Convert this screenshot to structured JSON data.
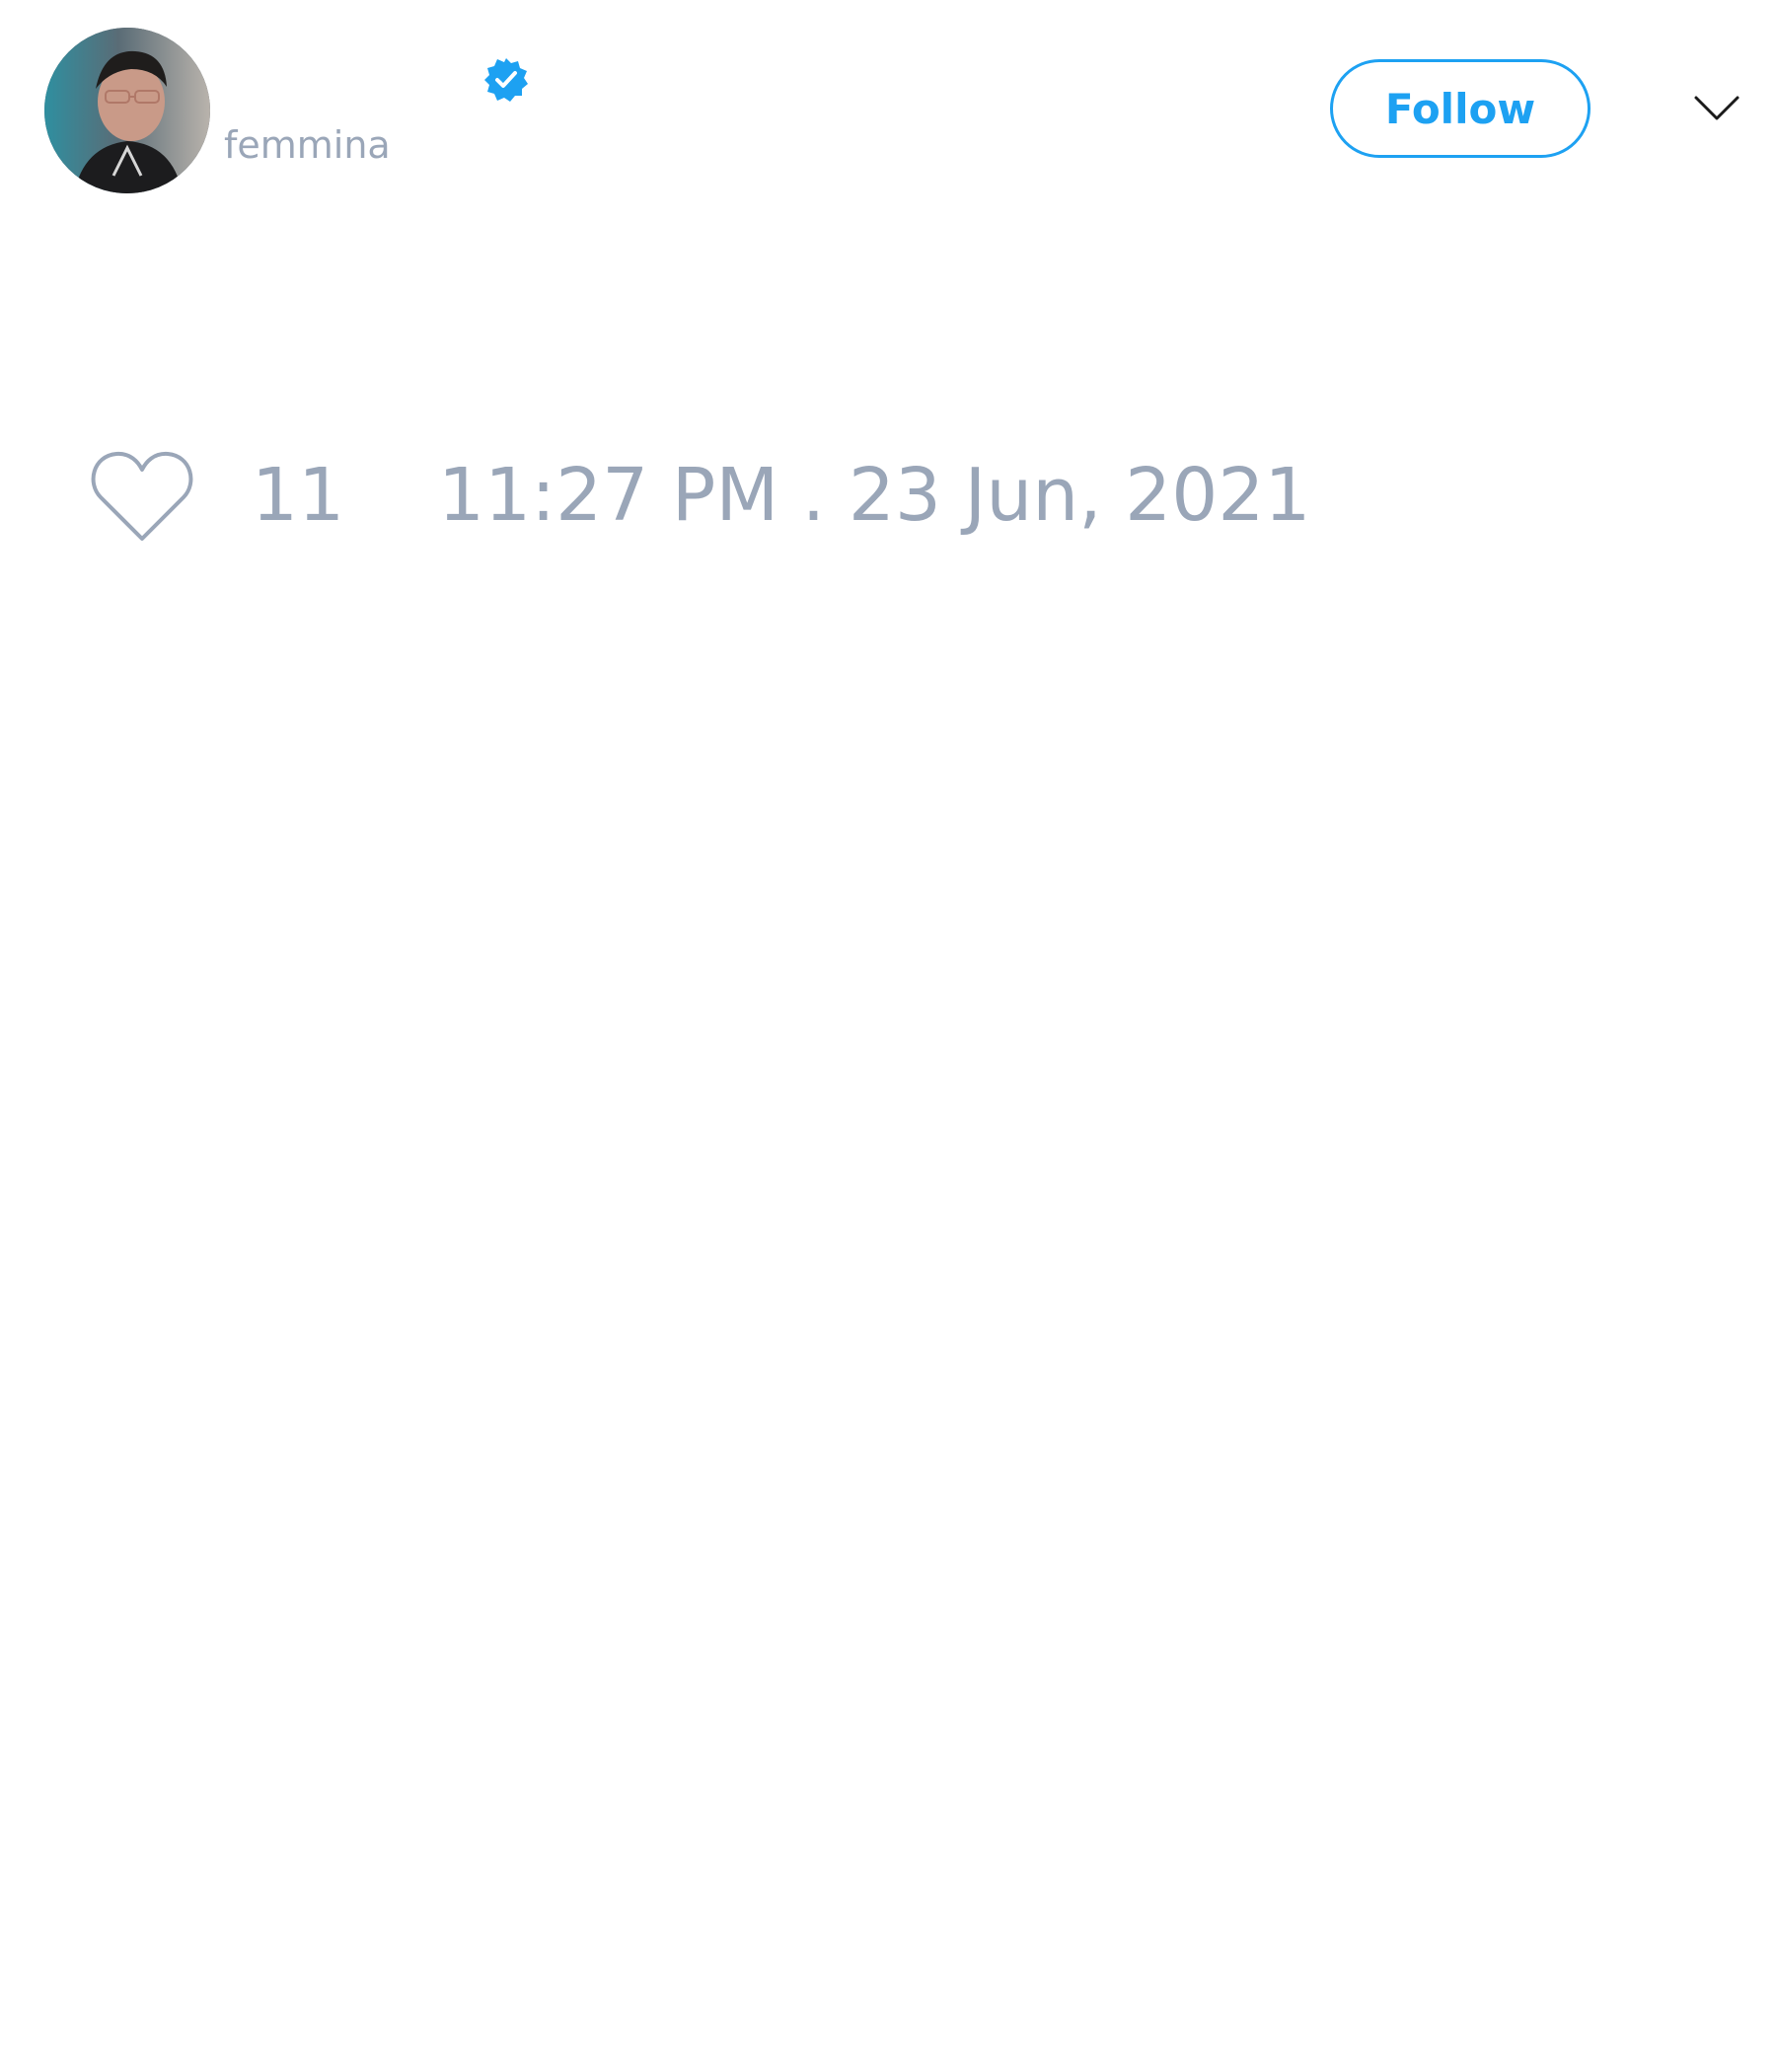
{
  "tweet": {
    "author": {
      "handle": "femmina",
      "verified": true,
      "avatar_icon": "profile-photo"
    },
    "follow_label": "Follow",
    "menu_icon": "chevron-down-icon",
    "like_icon": "heart-outline-icon",
    "like_count": "11",
    "timestamp": "11:27 PM . 23 Jun, 2021"
  },
  "colors": {
    "accent": "#1da1f2",
    "muted_text": "#9aa6b8",
    "background": "#ffffff"
  }
}
